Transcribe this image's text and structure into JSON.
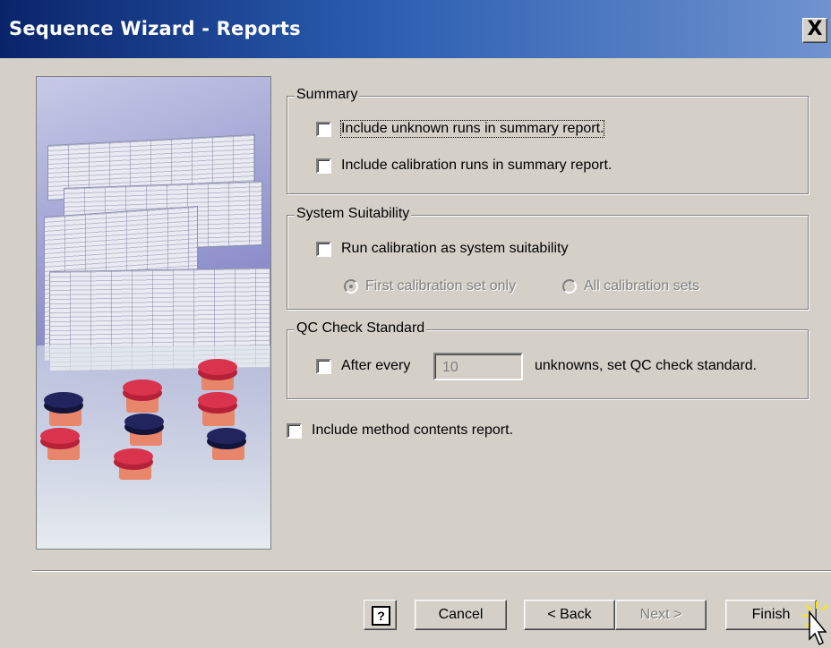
{
  "window": {
    "title": "Sequence Wizard - Reports",
    "close_label": "X"
  },
  "summary": {
    "legend": "Summary",
    "unknown_label": "Include unknown runs in summary report.",
    "calibration_label": "Include calibration runs in summary report."
  },
  "suitability": {
    "legend": "System Suitability",
    "run_label": "Run calibration as system suitability",
    "first_set_label": "First calibration set only",
    "all_sets_label": "All calibration sets"
  },
  "qc": {
    "legend": "QC Check Standard",
    "after_label": "After every",
    "every_value": "10",
    "suffix_label": "unknowns, set QC check standard."
  },
  "method": {
    "label": "Include method contents report."
  },
  "buttons": {
    "help": "?",
    "cancel": "Cancel",
    "back": "< Back",
    "next": "Next >",
    "finish": "Finish"
  }
}
